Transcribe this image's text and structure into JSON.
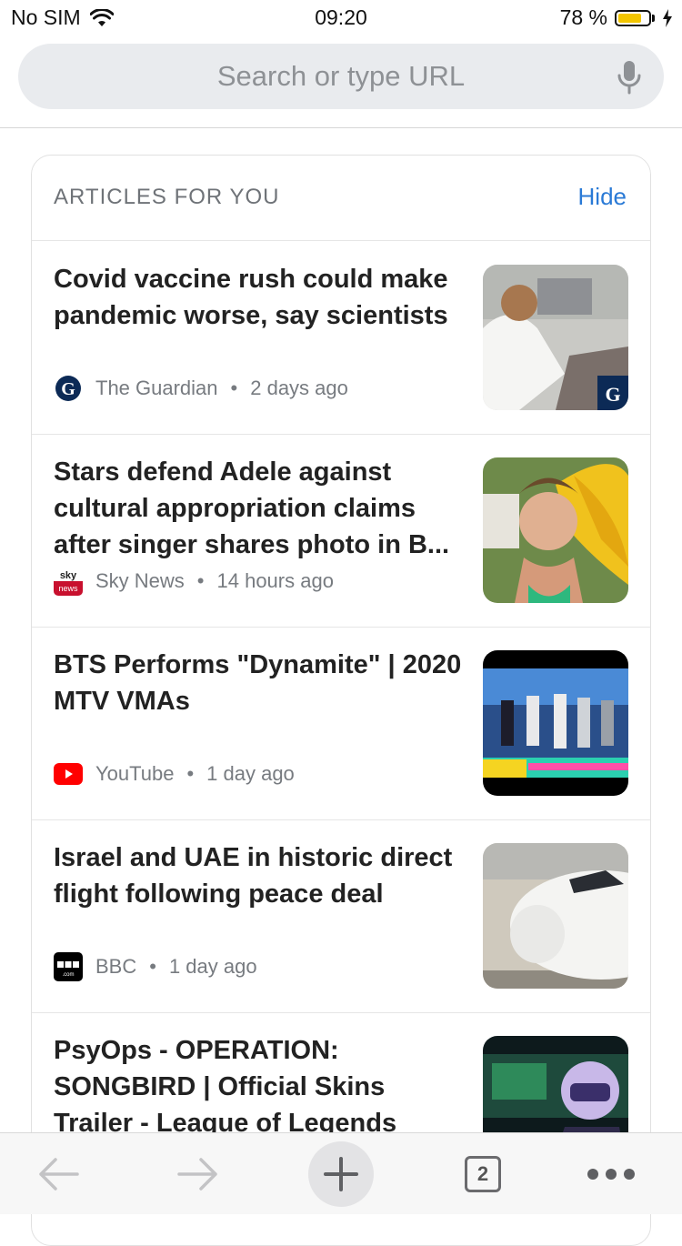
{
  "status_bar": {
    "carrier": "No SIM",
    "time": "09:20",
    "battery": "78 %",
    "battery_level": 0.78
  },
  "search": {
    "placeholder": "Search or type URL"
  },
  "feed": {
    "title": "ARTICLES FOR YOU",
    "hide_label": "Hide",
    "articles": [
      {
        "title": "Covid vaccine rush could make pandemic worse, say scientists",
        "source": "The Guardian",
        "time": "2 days ago",
        "logo": "guardian-logo"
      },
      {
        "title": "Stars defend Adele against cultural appropriation claims after singer shares photo in B...",
        "source": "Sky News",
        "time": "14 hours ago",
        "logo": "sky-news-logo"
      },
      {
        "title": "BTS Performs \"Dynamite\" | 2020 MTV VMAs",
        "source": "YouTube",
        "time": "1 day ago",
        "logo": "youtube-logo"
      },
      {
        "title": "Israel and UAE in historic direct flight following peace deal",
        "source": "BBC",
        "time": "1 day ago",
        "logo": "bbc-logo"
      },
      {
        "title": "PsyOps - OPERATION: SONGBIRD | Official Skins Trailer - League of Legends",
        "source": "",
        "time": "",
        "logo": ""
      }
    ]
  },
  "toolbar": {
    "tab_count": "2"
  }
}
